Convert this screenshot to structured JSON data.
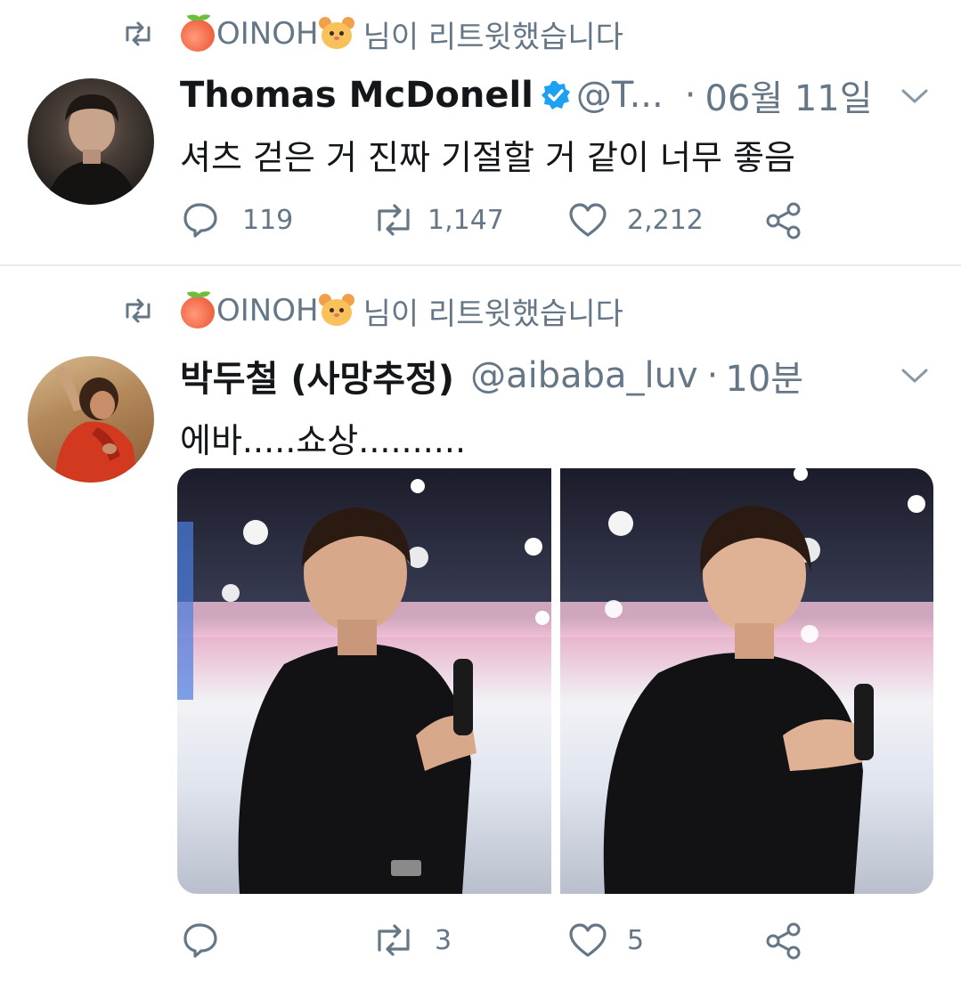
{
  "tweets": [
    {
      "retweeted_by_name": "OINOH",
      "retweeted_by_suffix": "님이 리트윗했습니다",
      "display_name": "Thomas McDonell",
      "verified": true,
      "handle": "@T...",
      "separator": "·",
      "time": "06월 11일",
      "text": "셔츠 걷은 거 진짜 기절할 거 같이 너무 좋음",
      "replies": "119",
      "retweets": "1,147",
      "likes": "2,212"
    },
    {
      "retweeted_by_name": "OINOH",
      "retweeted_by_suffix": "님이 리트윗했습니다",
      "display_name": "박두철 (사망추정)",
      "verified": false,
      "handle": "@aibaba_luv",
      "separator": "·",
      "time": "10분",
      "text": "에바.....쇼상..........",
      "replies": "",
      "retweets": "3",
      "likes": "5",
      "media_count": 2
    }
  ],
  "colors": {
    "accent": "#1da1f2",
    "secondary_text": "#657786",
    "divider": "#e6ecf0"
  },
  "icons": [
    "retweet-icon",
    "peach-emoji",
    "hamster-emoji",
    "verified-badge-icon",
    "chevron-down-icon",
    "reply-icon",
    "heart-icon",
    "share-icon"
  ]
}
